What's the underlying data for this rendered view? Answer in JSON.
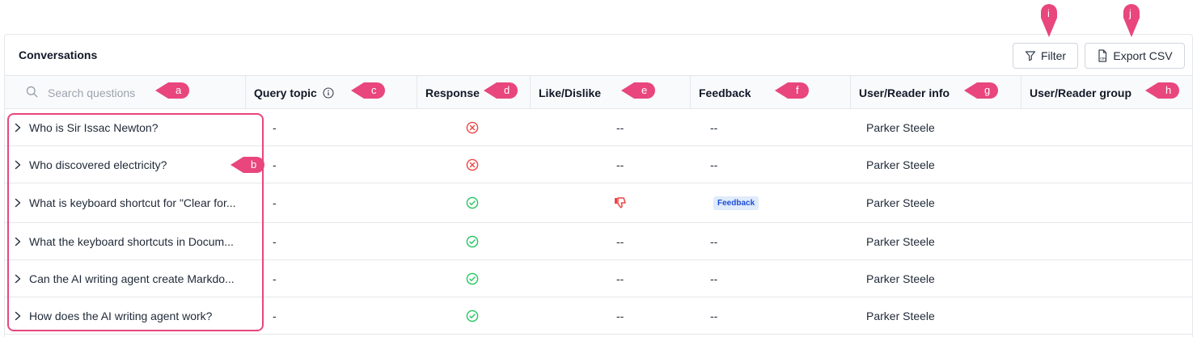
{
  "panel": {
    "title": "Conversations"
  },
  "toolbar": {
    "filter_label": "Filter",
    "filter_icon": "filter-funnel-icon",
    "export_label": "Export CSV",
    "export_icon": "csv-file-icon"
  },
  "search": {
    "placeholder": "Search questions"
  },
  "columns": {
    "query_topic": "Query topic",
    "response": "Response",
    "like_dislike": "Like/Dislike",
    "feedback": "Feedback",
    "user_info": "User/Reader info",
    "user_group": "User/Reader group"
  },
  "rows": [
    {
      "question": "Who is Sir Issac Newton?",
      "topic": "-",
      "response": "error",
      "like": "--",
      "feedback": "--",
      "user": "Parker Steele"
    },
    {
      "question": "Who discovered electricity?",
      "topic": "-",
      "response": "error",
      "like": "--",
      "feedback": "--",
      "user": "Parker Steele"
    },
    {
      "question": "What is keyboard shortcut for \"Clear for...",
      "topic": "-",
      "response": "success",
      "like": "dislike",
      "feedback": "Feedback",
      "user": "Parker Steele"
    },
    {
      "question": "What the keyboard shortcuts in Docum...",
      "topic": "-",
      "response": "success",
      "like": "--",
      "feedback": "--",
      "user": "Parker Steele"
    },
    {
      "question": "Can the AI writing agent create Markdo...",
      "topic": "-",
      "response": "success",
      "like": "--",
      "feedback": "--",
      "user": "Parker Steele"
    },
    {
      "question": "How does the AI writing agent work?",
      "topic": "-",
      "response": "success",
      "like": "--",
      "feedback": "--",
      "user": "Parker Steele"
    }
  ],
  "annotations": {
    "a": "a",
    "b": "b",
    "c": "c",
    "d": "d",
    "e": "e",
    "f": "f",
    "g": "g",
    "h": "h",
    "i": "i",
    "j": "j"
  },
  "colors": {
    "accent_callout": "#e8467c",
    "error": "#ef4444",
    "success": "#22c55e",
    "badge_bg": "#e0ebfb"
  }
}
